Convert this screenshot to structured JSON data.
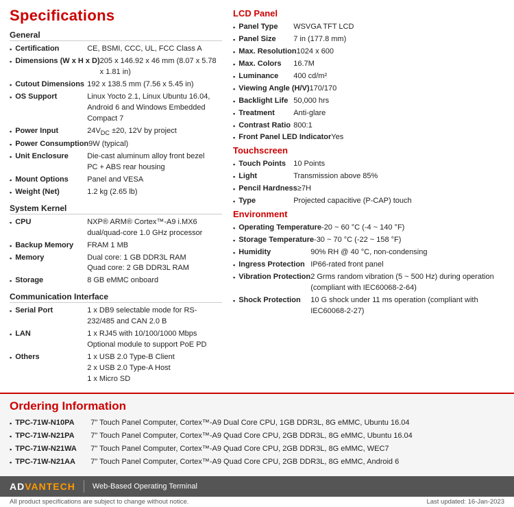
{
  "page": {
    "title": "Specifications"
  },
  "general": {
    "heading": "General",
    "items": [
      {
        "label": "Certification",
        "value": "CE, BSMI, CCC, UL, FCC Class A"
      },
      {
        "label": "Dimensions (W x H x D)",
        "value": "205 x 146.92 x 46 mm (8.07 x 5.78 x 1.81 in)"
      },
      {
        "label": "Cutout Dimensions",
        "value": "192 x 138.5 mm (7.56 x 5.45 in)"
      },
      {
        "label": "OS Support",
        "value": "Linux Yocto 2.1, Linux Ubuntu 16.04, Android 6 and Windows Embedded Compact 7"
      },
      {
        "label": "Power Input",
        "value": "24V± ±20, 12V by project"
      },
      {
        "label": "Power Consumption",
        "value": "9W (typical)"
      },
      {
        "label": "Unit Enclosure",
        "value": "Die-cast aluminum alloy front bezel\nPC + ABS rear housing"
      },
      {
        "label": "Mount Options",
        "value": "Panel and VESA"
      },
      {
        "label": "Weight (Net)",
        "value": "1.2 kg (2.65 lb)"
      }
    ]
  },
  "system_kernel": {
    "heading": "System Kernel",
    "items": [
      {
        "label": "CPU",
        "value": "NXP® ARM® Cortex™-A9 i.MX6 dual/quad-core 1.0 GHz processor"
      },
      {
        "label": "Backup Memory",
        "value": "FRAM 1 MB"
      },
      {
        "label": "Memory",
        "value": "Dual core: 1 GB DDR3L RAM\nQuad core: 2 GB DDR3L RAM"
      },
      {
        "label": "Storage",
        "value": "8 GB eMMC onboard"
      }
    ]
  },
  "communication": {
    "heading": "Communication Interface",
    "items": [
      {
        "label": "Serial Port",
        "value": "1 x DB9 selectable mode for RS-232/485 and CAN 2.0 B"
      },
      {
        "label": "LAN",
        "value": "1 x RJ45 with 10/100/1000 Mbps\nOptional module to support PoE PD"
      },
      {
        "label": "Others",
        "value": "1 x USB 2.0 Type-B Client\n2 x USB 2.0 Type-A Host\n1 x Micro SD"
      }
    ]
  },
  "lcd_panel": {
    "heading": "LCD Panel",
    "items": [
      {
        "label": "Panel Type",
        "value": "WSVGA TFT LCD"
      },
      {
        "label": "Panel Size",
        "value": "7 in (177.8 mm)"
      },
      {
        "label": "Max. Resolution",
        "value": "1024 x 600"
      },
      {
        "label": "Max. Colors",
        "value": "16.7M"
      },
      {
        "label": "Luminance",
        "value": "400 cd/m²"
      },
      {
        "label": "Viewing Angle (H/V)",
        "value": "170/170"
      },
      {
        "label": "Backlight Life",
        "value": "50,000 hrs"
      },
      {
        "label": "Treatment",
        "value": "Anti-glare"
      },
      {
        "label": "Contrast Ratio",
        "value": "800:1"
      },
      {
        "label": "Front Panel LED Indicator",
        "value": "Yes"
      }
    ]
  },
  "touchscreen": {
    "heading": "Touchscreen",
    "items": [
      {
        "label": "Touch Points",
        "value": "10 Points"
      },
      {
        "label": "Light",
        "value": "Transmission above 85%"
      },
      {
        "label": "Pencil Hardness",
        "value": "≥7H"
      },
      {
        "label": "Type",
        "value": "Projected capacitive (P-CAP) touch"
      }
    ]
  },
  "environment": {
    "heading": "Environment",
    "items": [
      {
        "label": "Operating Temperature",
        "value": "-20 ~ 60 °C (-4 ~ 140 °F)"
      },
      {
        "label": "Storage Temperature",
        "value": "-30 ~ 70 °C (-22 ~ 158 °F)"
      },
      {
        "label": "Humidity",
        "value": "90% RH @ 40 °C, non-condensing"
      },
      {
        "label": "Ingress Protection",
        "value": "IP66-rated front panel"
      },
      {
        "label": "Vibration Protection",
        "value": "2 Grms random vibration (5 ~ 500 Hz) during operation (compliant with IEC60068-2-64)"
      },
      {
        "label": "Shock Protection",
        "value": "10 G shock under 11 ms operation (compliant with IEC60068-2-27)"
      }
    ]
  },
  "ordering": {
    "heading": "Ordering Information",
    "items": [
      {
        "code": "TPC-71W-N10PA",
        "desc": "7\" Touch Panel Computer, Cortex™-A9 Dual Core CPU, 1GB DDR3L, 8G eMMC, Ubuntu 16.04"
      },
      {
        "code": "TPC-71W-N21PA",
        "desc": "7\" Touch Panel Computer, Cortex™-A9 Quad Core CPU, 2GB DDR3L, 8G eMMC, Ubuntu 16.04"
      },
      {
        "code": "TPC-71W-N21WA",
        "desc": "7\" Touch Panel Computer, Cortex™-A9 Quad Core CPU, 2GB DDR3L, 8G eMMC, WEC7"
      },
      {
        "code": "TPC-71W-N21AA",
        "desc": "7\" Touch Panel Computer, Cortex™-A9 Quad Core CPU, 2GB DDR3L, 8G eMMC, Android 6"
      }
    ]
  },
  "footer": {
    "logo_adv": "AD",
    "logo_antech": "VANTECH",
    "logo_symbol": "®",
    "tagline": "Web-Based Operating Terminal",
    "note_left": "All product specifications are subject to change without notice.",
    "note_right": "Last updated: 16-Jan-2023"
  }
}
